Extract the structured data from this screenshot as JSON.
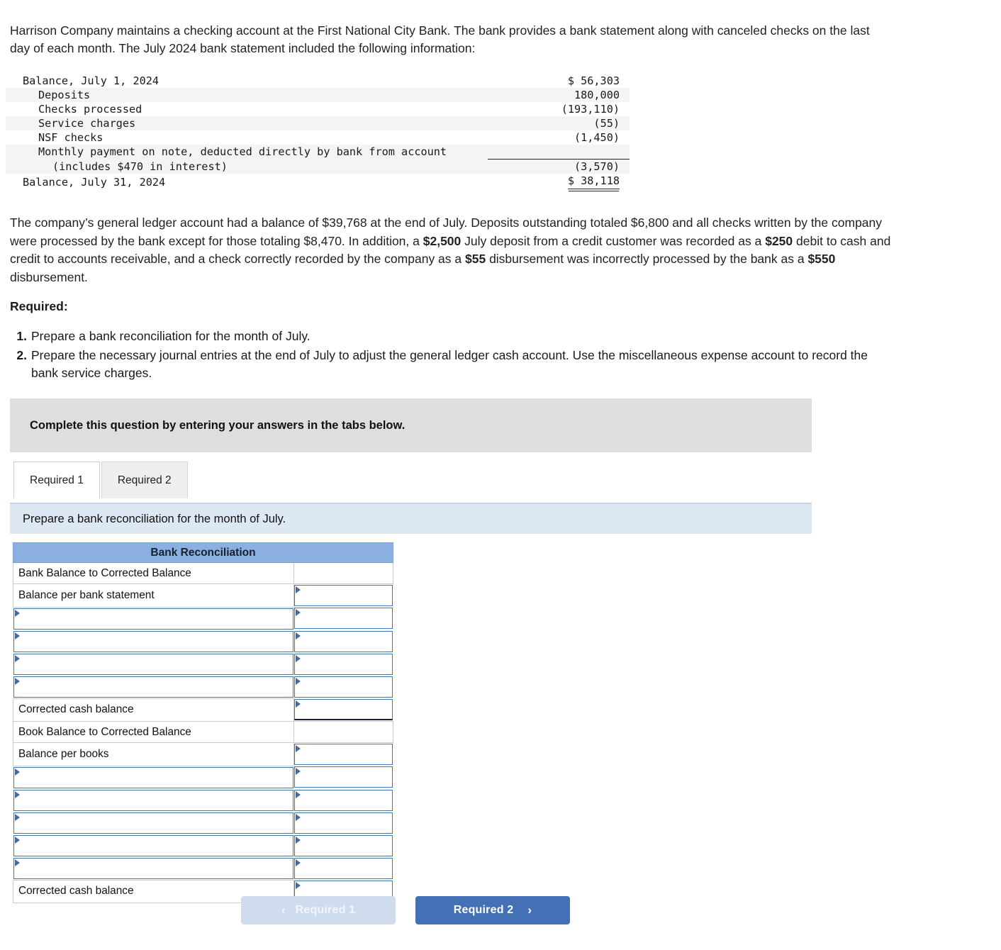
{
  "intro": {
    "text": "Harrison Company maintains a checking account at the First National City Bank. The bank provides a bank statement along with canceled checks on the last day of each month. The July 2024 bank statement included the following information:"
  },
  "statement": {
    "rows": [
      {
        "label": "Balance, July 1, 2024",
        "amount": "$ 56,303",
        "indent": 0,
        "alt": false,
        "rule": false,
        "double": false
      },
      {
        "label": "Deposits",
        "amount": "180,000",
        "indent": 1,
        "alt": true,
        "rule": false,
        "double": false
      },
      {
        "label": "Checks processed",
        "amount": "(193,110)",
        "indent": 1,
        "alt": false,
        "rule": false,
        "double": false
      },
      {
        "label": "Service charges",
        "amount": "(55)",
        "indent": 1,
        "alt": true,
        "rule": false,
        "double": false
      },
      {
        "label": "NSF checks",
        "amount": "(1,450)",
        "indent": 1,
        "alt": false,
        "rule": false,
        "double": false
      },
      {
        "label": "Monthly payment on note, deducted directly by bank from account",
        "amount": "",
        "indent": 1,
        "alt": true,
        "rule": false,
        "double": false
      },
      {
        "label": "(includes $470 in interest)",
        "amount": "(3,570)",
        "indent": 2,
        "alt": true,
        "rule": true,
        "double": false
      },
      {
        "label": "Balance, July 31, 2024",
        "amount": "$ 38,118",
        "indent": 0,
        "alt": false,
        "rule": false,
        "double": true
      }
    ]
  },
  "paragraph": {
    "segments": [
      {
        "t": "The company’s general ledger account had a balance of $39,768 at the end of July. Deposits outstanding totaled $6,800 and all checks written by the company were processed by the bank except for those totaling $8,470. In addition, a ",
        "b": false
      },
      {
        "t": "$2,500",
        "b": true
      },
      {
        "t": " July deposit from a credit customer was recorded as a ",
        "b": false
      },
      {
        "t": "$250",
        "b": true
      },
      {
        "t": " debit to cash and credit to accounts receivable, and a check correctly recorded by the company as a ",
        "b": false
      },
      {
        "t": "$55",
        "b": true
      },
      {
        "t": " disbursement was incorrectly processed by the bank as a ",
        "b": false
      },
      {
        "t": "$550",
        "b": true
      },
      {
        "t": " disbursement.",
        "b": false
      }
    ]
  },
  "required": {
    "title": "Required:",
    "items": [
      {
        "num": "1.",
        "text": "Prepare a bank reconciliation for the month of July."
      },
      {
        "num": "2.",
        "text": "Prepare the necessary journal entries at the end of July to adjust the general ledger cash account. Use the miscellaneous expense account to record the bank service charges."
      }
    ]
  },
  "banner": {
    "instruction": "Complete this question by entering your answers in the tabs below."
  },
  "tabs": [
    {
      "label": "Required 1",
      "active": true
    },
    {
      "label": "Required 2",
      "active": false
    }
  ],
  "prompt": {
    "text": "Prepare a bank reconciliation for the month of July."
  },
  "recon": {
    "title": "Bank Reconciliation",
    "rows": [
      {
        "label": "Bank Balance to Corrected Balance",
        "left": "label",
        "right": "plain"
      },
      {
        "label": "Balance per bank statement",
        "left": "label",
        "right": "input"
      },
      {
        "label": "",
        "left": "input",
        "right": "input"
      },
      {
        "label": "",
        "left": "input",
        "right": "input"
      },
      {
        "label": "",
        "left": "input",
        "right": "input"
      },
      {
        "label": "",
        "left": "input",
        "right": "input"
      },
      {
        "label": "Corrected cash balance",
        "left": "label",
        "right": "input-total"
      },
      {
        "label": "Book Balance to Corrected Balance",
        "left": "label",
        "right": "plain"
      },
      {
        "label": "Balance per books",
        "left": "label",
        "right": "input"
      },
      {
        "label": "",
        "left": "input",
        "right": "input"
      },
      {
        "label": "",
        "left": "input",
        "right": "input"
      },
      {
        "label": "",
        "left": "input",
        "right": "input"
      },
      {
        "label": "",
        "left": "input",
        "right": "input"
      },
      {
        "label": "",
        "left": "input",
        "right": "input"
      },
      {
        "label": "Corrected cash balance",
        "left": "label",
        "right": "input-total"
      }
    ]
  },
  "nav": {
    "prev_label": "Required 1",
    "prev_chevron": "‹",
    "next_label": "Required 2",
    "next_chevron": "›"
  },
  "colors": {
    "header_blue": "#8bafe0",
    "input_border": "#4472b8",
    "banner_gray": "#dedede",
    "banner_blue": "#dee8f5",
    "button_blue": "#4470b5",
    "button_disabled": "#cfdcee"
  }
}
